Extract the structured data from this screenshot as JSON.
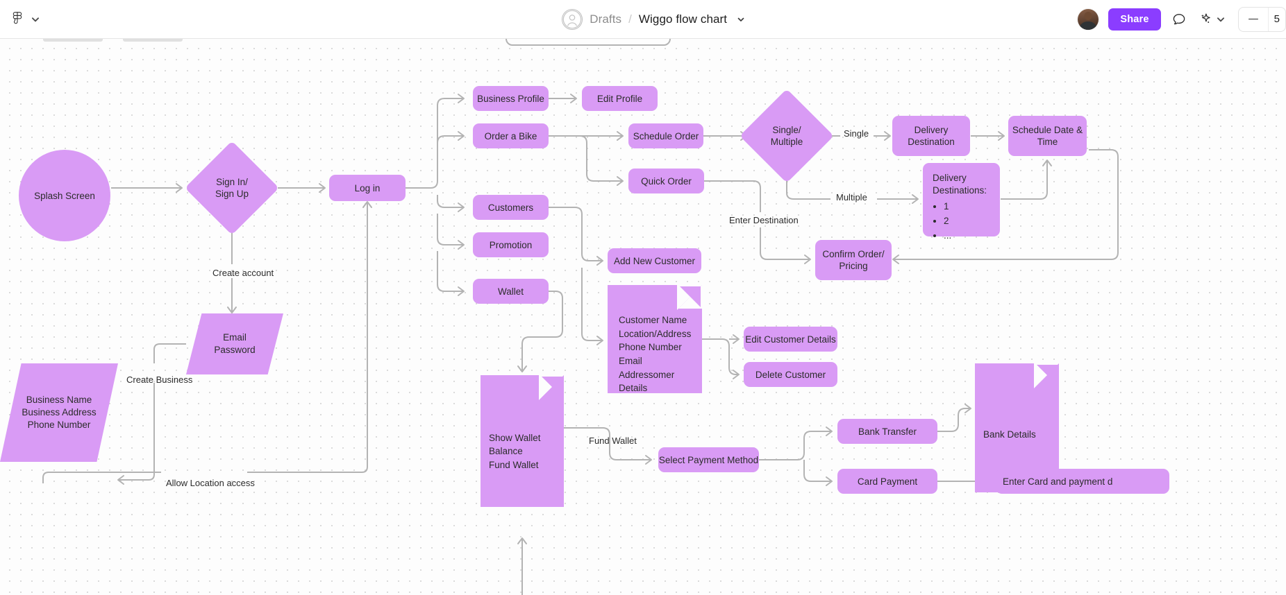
{
  "topbar": {
    "logo_icon": "figma-logo-icon",
    "main_menu_chevron": "chevron-down-icon",
    "file_avatar_icon": "user-circle-icon",
    "breadcrumb_project": "Drafts",
    "breadcrumb_separator": "/",
    "breadcrumb_file": "Wiggo flow chart",
    "file_menu_chevron": "chevron-down-icon",
    "share_label": "Share",
    "comment_icon": "comment-bubble-icon",
    "ai_icon": "ai-sparkle-icon",
    "ai_chevron": "chevron-down-icon",
    "zoom_minus_icon": "minus-icon",
    "zoom_value": "5",
    "accent_color": "#8b3dff"
  },
  "canvas": {
    "node_fill": "#D99BF5",
    "edge_color": "#b3b3b3",
    "text_color": "#2b2b2b",
    "nodes": {
      "splash_screen": "Splash Screen",
      "sign_in_sign_up": "Sign In/\nSign Up",
      "log_in": "Log in",
      "email_password": "Email\nPassword",
      "business_info": "Business Name\nBusiness Address\nPhone Number",
      "business_profile": "Business Profile",
      "edit_profile": "Edit Profile",
      "order_a_bike": "Order a Bike",
      "schedule_order": "Schedule Order",
      "quick_order": "Quick Order",
      "customers": "Customers",
      "promotion": "Promotion",
      "wallet": "Wallet",
      "single_multiple": "Single/\nMultiple",
      "delivery_destination": "Delivery\nDestination",
      "schedule_date_time": "Schedule Date &\nTime",
      "delivery_destinations_title": "Delivery\nDestinations:",
      "delivery_destinations_items": [
        "1",
        "2",
        "..."
      ],
      "confirm_order_pricing": "Confirm Order/\nPricing",
      "add_new_customer": "Add New Customer",
      "customer_details": "Customer Name\nLocation/Address\nPhone Number\nEmail Addressomer\nDetails",
      "edit_customer_details": "Edit Customer Details",
      "delete_customer": "Delete Customer",
      "show_wallet_balance": "Show Wallet Balance\nFund Wallet",
      "select_payment_method": "Select Payment Method",
      "bank_transfer": "Bank Transfer",
      "bank_details": "Bank Details",
      "card_payment": "Card Payment",
      "enter_card_payment": "Enter Card and payment d"
    },
    "edge_labels": {
      "create_account": "Create account",
      "create_business": "Create Business",
      "allow_location_access": "Allow Location access",
      "single": "Single",
      "multiple": "Multiple",
      "enter_destination": "Enter Destination",
      "fund_wallet": "Fund Wallet"
    }
  }
}
